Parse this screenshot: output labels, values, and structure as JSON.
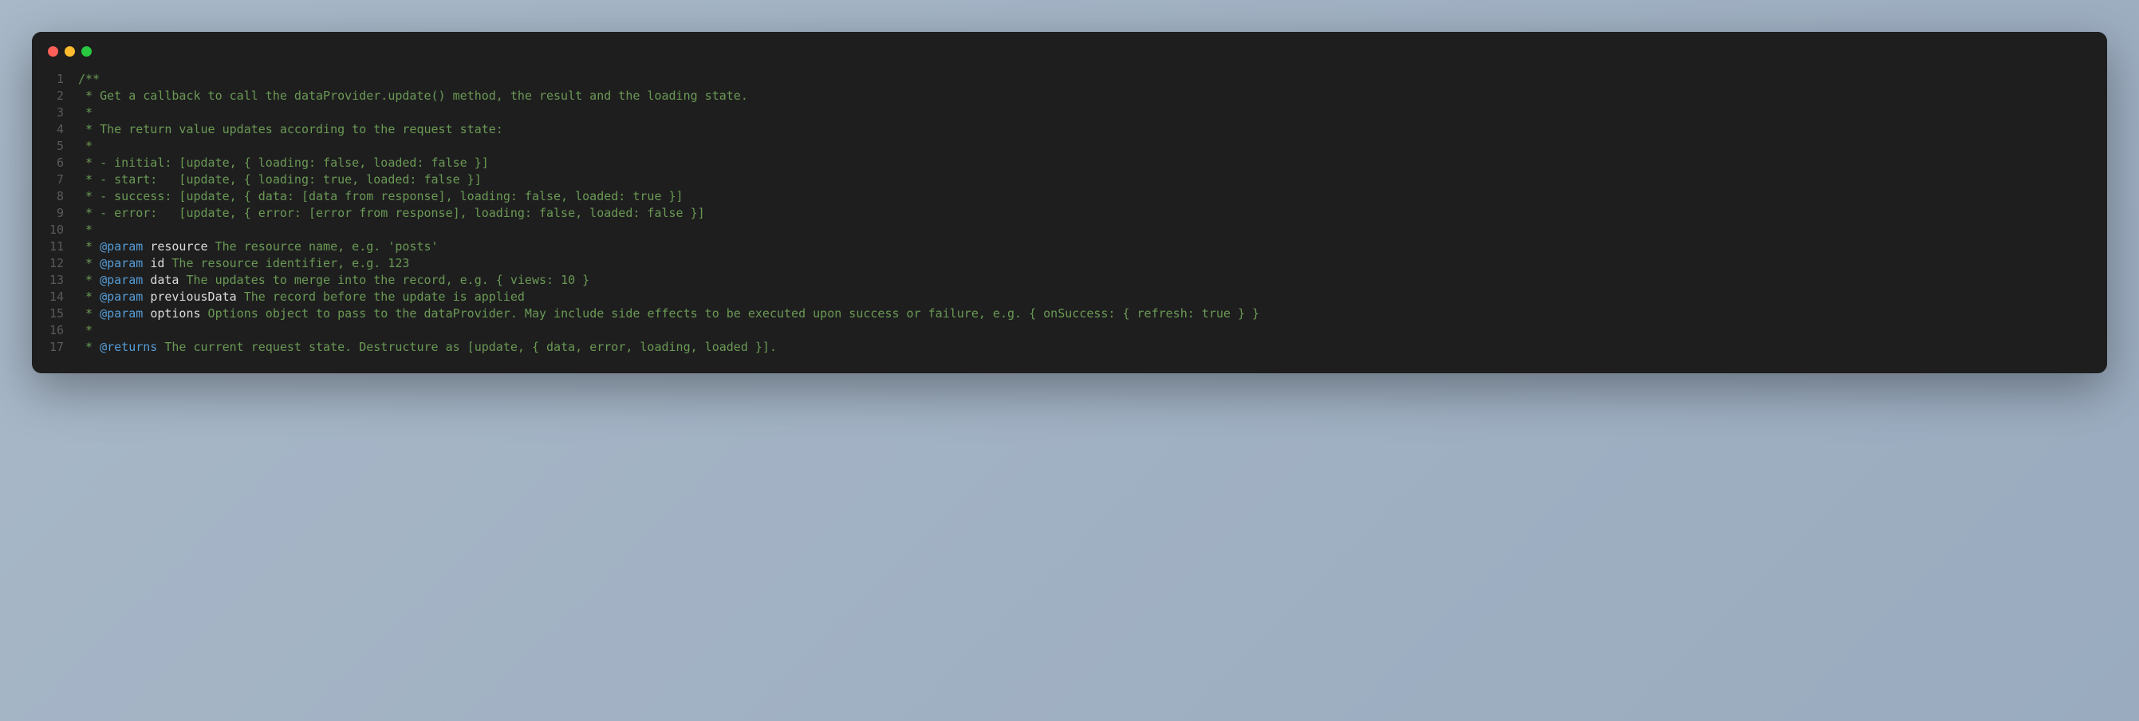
{
  "window": {
    "controls": [
      "close",
      "minimize",
      "maximize"
    ]
  },
  "code": {
    "lines": [
      {
        "n": 1,
        "tokens": [
          {
            "t": "comment",
            "v": "/**"
          }
        ]
      },
      {
        "n": 2,
        "tokens": [
          {
            "t": "comment",
            "v": " * Get a callback to call the dataProvider.update() method, the result and the loading state."
          }
        ]
      },
      {
        "n": 3,
        "tokens": [
          {
            "t": "comment",
            "v": " *"
          }
        ]
      },
      {
        "n": 4,
        "tokens": [
          {
            "t": "comment",
            "v": " * The return value updates according to the request state:"
          }
        ]
      },
      {
        "n": 5,
        "tokens": [
          {
            "t": "comment",
            "v": " *"
          }
        ]
      },
      {
        "n": 6,
        "tokens": [
          {
            "t": "comment",
            "v": " * - initial: [update, { loading: false, loaded: false }]"
          }
        ]
      },
      {
        "n": 7,
        "tokens": [
          {
            "t": "comment",
            "v": " * - start:   [update, { loading: true, loaded: false }]"
          }
        ]
      },
      {
        "n": 8,
        "tokens": [
          {
            "t": "comment",
            "v": " * - success: [update, { data: [data from response], loading: false, loaded: true }]"
          }
        ]
      },
      {
        "n": 9,
        "tokens": [
          {
            "t": "comment",
            "v": " * - error:   [update, { error: [error from response], loading: false, loaded: false }]"
          }
        ]
      },
      {
        "n": 10,
        "tokens": [
          {
            "t": "comment",
            "v": " *"
          }
        ]
      },
      {
        "n": 11,
        "tokens": [
          {
            "t": "comment",
            "v": " * "
          },
          {
            "t": "tag",
            "v": "@param"
          },
          {
            "t": "comment",
            "v": " "
          },
          {
            "t": "paramname",
            "v": "resource"
          },
          {
            "t": "comment",
            "v": " The resource name, e.g. 'posts'"
          }
        ]
      },
      {
        "n": 12,
        "tokens": [
          {
            "t": "comment",
            "v": " * "
          },
          {
            "t": "tag",
            "v": "@param"
          },
          {
            "t": "comment",
            "v": " "
          },
          {
            "t": "paramname",
            "v": "id"
          },
          {
            "t": "comment",
            "v": " The resource identifier, e.g. 123"
          }
        ]
      },
      {
        "n": 13,
        "tokens": [
          {
            "t": "comment",
            "v": " * "
          },
          {
            "t": "tag",
            "v": "@param"
          },
          {
            "t": "comment",
            "v": " "
          },
          {
            "t": "paramname",
            "v": "data"
          },
          {
            "t": "comment",
            "v": " The updates to merge into the record, e.g. { views: 10 }"
          }
        ]
      },
      {
        "n": 14,
        "tokens": [
          {
            "t": "comment",
            "v": " * "
          },
          {
            "t": "tag",
            "v": "@param"
          },
          {
            "t": "comment",
            "v": " "
          },
          {
            "t": "paramname",
            "v": "previousData"
          },
          {
            "t": "comment",
            "v": " The record before the update is applied"
          }
        ]
      },
      {
        "n": 15,
        "tokens": [
          {
            "t": "comment",
            "v": " * "
          },
          {
            "t": "tag",
            "v": "@param"
          },
          {
            "t": "comment",
            "v": " "
          },
          {
            "t": "paramname",
            "v": "options"
          },
          {
            "t": "comment",
            "v": " Options object to pass to the dataProvider. May include side effects to be executed upon success or failure, e.g. { onSuccess: { refresh: true } }"
          }
        ]
      },
      {
        "n": 16,
        "tokens": [
          {
            "t": "comment",
            "v": " *"
          }
        ]
      },
      {
        "n": 17,
        "tokens": [
          {
            "t": "comment",
            "v": " * "
          },
          {
            "t": "tag",
            "v": "@returns"
          },
          {
            "t": "comment",
            "v": " The current request state. Destructure as [update, { data, error, loading, loaded }]."
          }
        ]
      }
    ]
  }
}
